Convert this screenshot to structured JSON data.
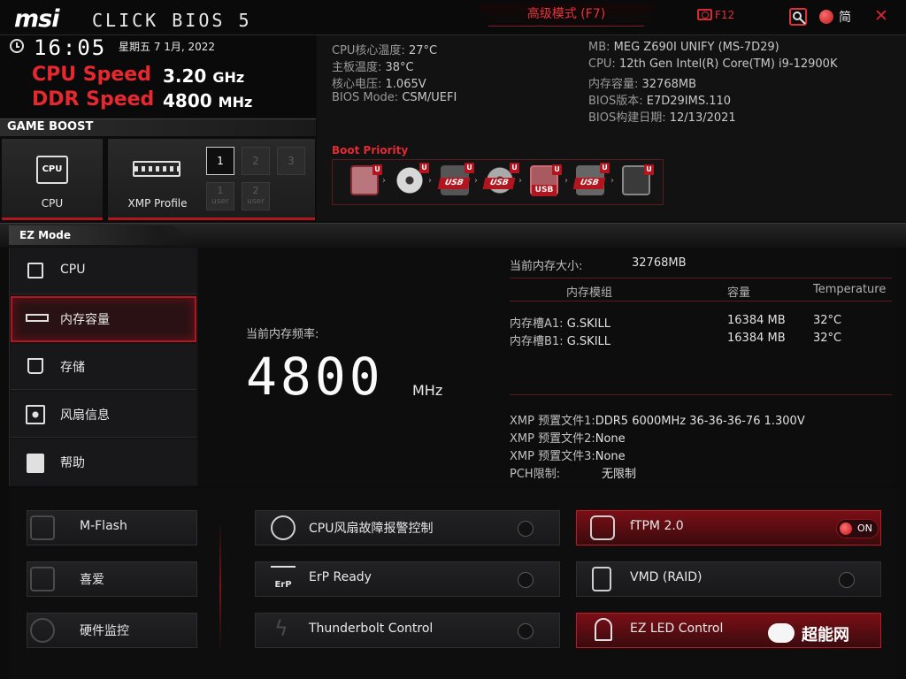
{
  "header": {
    "brand": "msi",
    "product": "CLICK BIOS 5",
    "advanced_mode": "高级模式 (F7)",
    "screenshot": "F12",
    "language": "简"
  },
  "clock": {
    "time": "16:05",
    "date": "星期五  7 1月, 2022",
    "cpu_speed_label": "CPU Speed",
    "cpu_speed_value": "3.20",
    "cpu_speed_unit": "GHz",
    "ddr_speed_label": "DDR Speed",
    "ddr_speed_value": "4800",
    "ddr_speed_unit": "MHz"
  },
  "sysinfo": {
    "left": [
      {
        "label": "CPU核心温度: ",
        "value": "27°C"
      },
      {
        "label": "主板温度: ",
        "value": "38°C"
      },
      {
        "label": "核心电压: ",
        "value": "1.065V"
      },
      {
        "label": "BIOS Mode: ",
        "value": "CSM/UEFI"
      }
    ],
    "right": [
      {
        "label": "MB: ",
        "value": "MEG Z690I UNIFY (MS-7D29)"
      },
      {
        "label": "CPU: ",
        "value": "12th Gen Intel(R) Core(TM) i9-12900K"
      },
      {
        "label": "内存容量: ",
        "value": "32768MB"
      },
      {
        "label": "BIOS版本: ",
        "value": "E7D29IMS.110"
      },
      {
        "label": "BIOS构建日期: ",
        "value": "12/13/2021"
      }
    ]
  },
  "game_boost": {
    "title": "GAME BOOST",
    "cpu_label": "CPU",
    "cpu_chip": "CPU",
    "xmp_label": "XMP Profile",
    "profiles": [
      "1",
      "2",
      "3"
    ],
    "user_profiles": [
      "1",
      "2"
    ],
    "user_word": "user"
  },
  "boot": {
    "title": "Boot Priority",
    "badge": "U",
    "usb": "USB",
    "devices": [
      "hdd-icon",
      "optical-disc-icon",
      "usb-drive-icon",
      "usb-optical-icon",
      "usb-key-icon",
      "usb-floppy-icon",
      "network-icon"
    ]
  },
  "ez": {
    "title": "EZ Mode",
    "nav": [
      {
        "label": "CPU",
        "icon": "cpu-icon"
      },
      {
        "label": "内存容量",
        "icon": "memory-icon"
      },
      {
        "label": "存储",
        "icon": "storage-icon"
      },
      {
        "label": "风扇信息",
        "icon": "fan-icon"
      },
      {
        "label": "帮助",
        "icon": "hotkey-icon"
      }
    ],
    "memory": {
      "freq_label": "当前内存频率:",
      "freq_value": "4800",
      "freq_unit": "MHz",
      "size_label": "当前内存大小:",
      "size_value": "32768MB",
      "col_module": "内存模组",
      "col_capacity": "容量",
      "col_temp": "Temperature",
      "slots": [
        {
          "slot": "内存槽A1:",
          "module": "G.SKILL",
          "capacity": "16384 MB",
          "temp": "32°C"
        },
        {
          "slot": "内存槽B1:",
          "module": "G.SKILL",
          "capacity": "16384 MB",
          "temp": "32°C"
        }
      ],
      "xmp": [
        {
          "label": "XMP 预置文件1:",
          "value": "DDR5 6000MHz 36-36-36-76 1.300V"
        },
        {
          "label": "XMP 预置文件2:",
          "value": "None"
        },
        {
          "label": "XMP 预置文件3:",
          "value": "None"
        }
      ],
      "pch_label": "PCH限制:",
      "pch_value": "无限制"
    }
  },
  "features": {
    "left": [
      "M-Flash",
      "喜爱",
      "硬件监控"
    ],
    "middle": [
      "CPU风扇故障报警控制",
      "ErP Ready",
      "Thunderbolt Control"
    ],
    "right": [
      "fTPM 2.0",
      "VMD (RAID)",
      "EZ LED Control"
    ],
    "on_label": "ON",
    "erp_abbr": "ErP"
  },
  "watermark": "超能网",
  "colors": {
    "accent": "#e8282f",
    "panel": "#141415",
    "button_red": "#7a0f16"
  }
}
